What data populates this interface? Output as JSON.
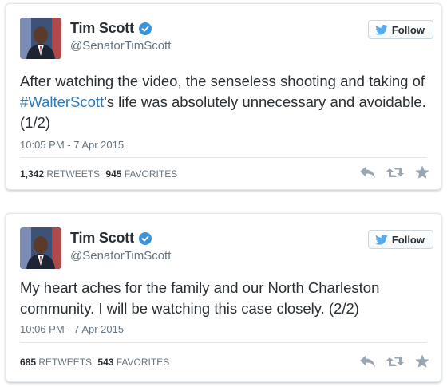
{
  "tweets": [
    {
      "author_name": "Tim Scott",
      "handle": "@SenatorTimScott",
      "follow_label": "Follow",
      "text_before": "After watching the video, the senseless shooting and taking of ",
      "hashtag": "#WalterScott",
      "text_after": "'s life was absolutely unnecessary and avoidable. (1/2)",
      "timestamp": "10:05 PM - 7 Apr 2015",
      "retweets": "1,342",
      "retweets_label": "RETWEETS",
      "favorites": "945",
      "favorites_label": "FAVORITES"
    },
    {
      "author_name": "Tim Scott",
      "handle": "@SenatorTimScott",
      "follow_label": "Follow",
      "text_before": "My heart aches for the family and our North Charleston community. I will be watching this case closely. (2/2)",
      "hashtag": "",
      "text_after": "",
      "timestamp": "10:06 PM - 7 Apr 2015",
      "retweets": "685",
      "retweets_label": "RETWEETS",
      "favorites": "543",
      "favorites_label": "FAVORITES"
    }
  ],
  "colors": {
    "link": "#2b7bb9",
    "verified": "#3b94d9",
    "twitter_bird": "#55acee",
    "muted": "#66757f",
    "icon": "#9aa6b1"
  },
  "icons": [
    "verified-badge-icon",
    "twitter-bird-icon",
    "reply-icon",
    "retweet-icon",
    "favorite-star-icon"
  ]
}
